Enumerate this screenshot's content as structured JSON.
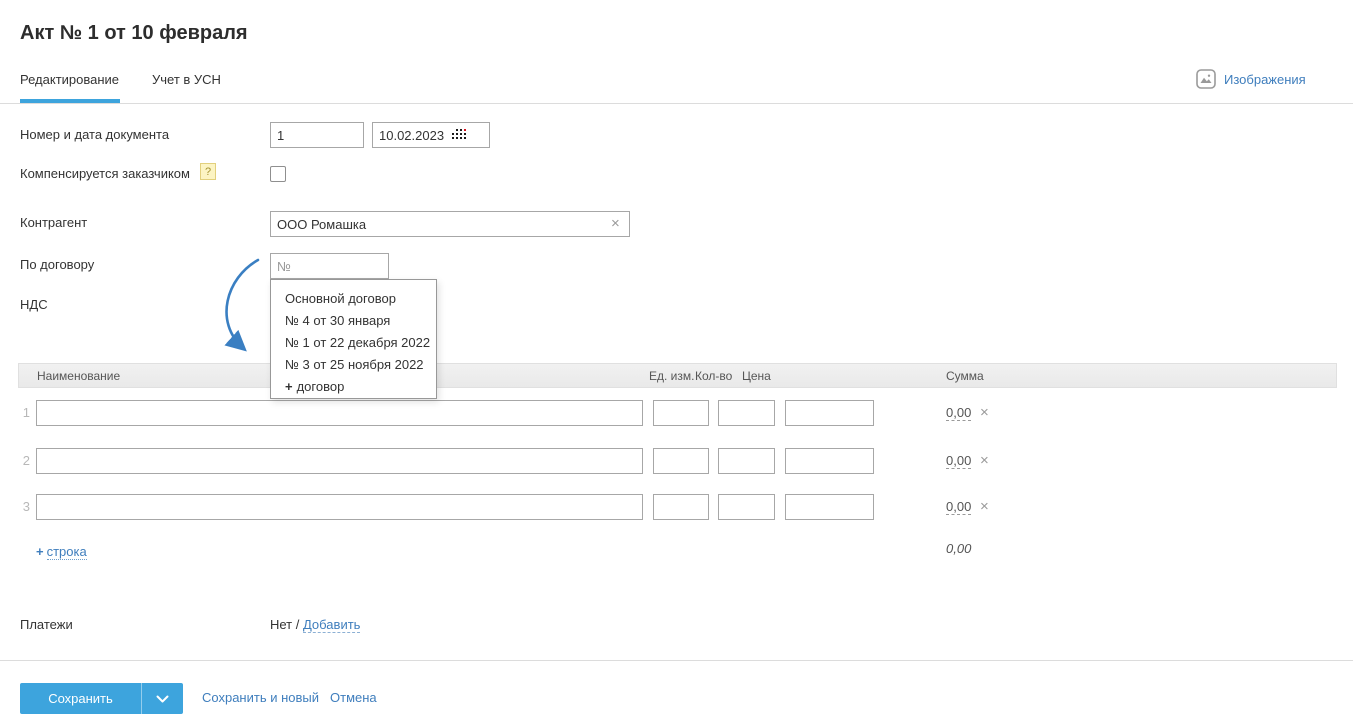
{
  "page": {
    "title": "Акт № 1 от 10 февраля"
  },
  "tabs": [
    {
      "label": "Редактирование",
      "active": true
    },
    {
      "label": "Учет в УСН",
      "active": false
    }
  ],
  "images_link": {
    "label": "Изображения"
  },
  "form": {
    "number_date": {
      "label": "Номер и дата документа",
      "number_value": "1",
      "date_value": "10.02.2023"
    },
    "compensated": {
      "label": "Компенсируется заказчиком",
      "help": "?",
      "checked": false
    },
    "counterparty": {
      "label": "Контрагент",
      "value": "ООО Ромашка",
      "clear": "×"
    },
    "contract": {
      "label": "По договору",
      "placeholder": "№"
    },
    "vat": {
      "label": "НДС"
    }
  },
  "contract_dropdown": {
    "items": [
      "Основной договор",
      "№ 4 от 30 января",
      "№ 1 от 22 декабря 2022",
      "№ 3 от 25 ноября 2022"
    ],
    "add_item": {
      "plus": "+",
      "label": "договор"
    }
  },
  "table": {
    "headers": {
      "name": "Наименование",
      "unit": "Ед. изм.",
      "qty": "Кол-во",
      "price": "Цена",
      "sum": "Сумма"
    },
    "rows": [
      {
        "index": "1",
        "sum": "0,00",
        "delete": "×"
      },
      {
        "index": "2",
        "sum": "0,00",
        "delete": "×"
      },
      {
        "index": "3",
        "sum": "0,00",
        "delete": "×"
      }
    ],
    "add_row": {
      "plus": "+",
      "label": "строка"
    },
    "total": "0,00"
  },
  "payments": {
    "label": "Платежи",
    "prefix": "Нет / ",
    "add_label": "Добавить"
  },
  "footer": {
    "save": "Сохранить",
    "save_and_new": "Сохранить и новый",
    "cancel": "Отмена"
  },
  "colors": {
    "accent_blue": "#3da4dd",
    "link_blue": "#3f7ebd",
    "arrow_blue": "#3a7fc2"
  }
}
